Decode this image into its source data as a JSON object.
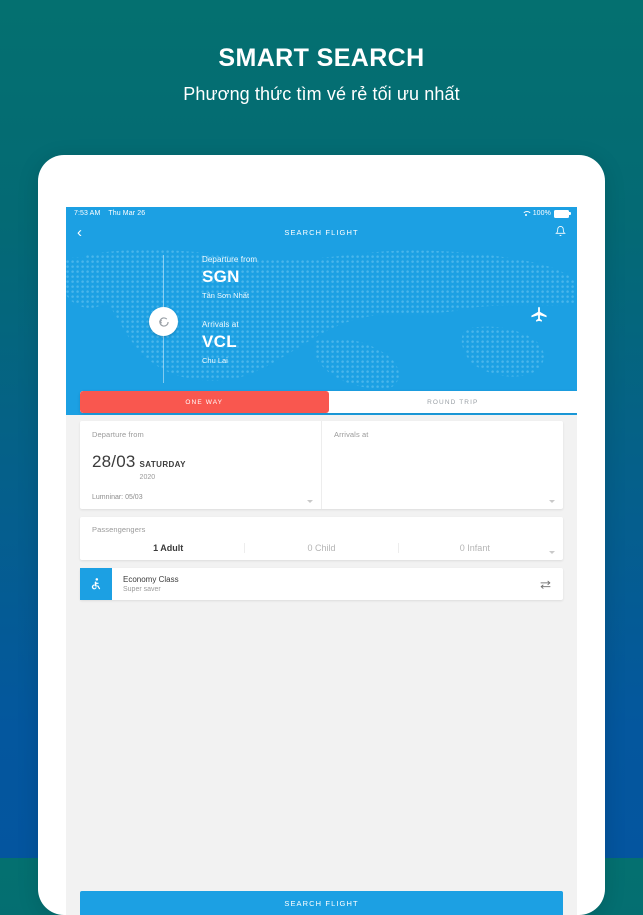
{
  "promo": {
    "title": "SMART SEARCH",
    "subtitle": "Phương thức tìm vé rẻ tối ưu nhất"
  },
  "statusbar": {
    "time": "7:53 AM",
    "date": "Thu Mar 26",
    "battery_pct": "100%",
    "wifi_icon": "wifi-icon",
    "battery_icon": "battery-icon"
  },
  "navbar": {
    "back_icon": "chevron-left-icon",
    "title": "SEARCH FLIGHT",
    "bell_icon": "bell-icon"
  },
  "hero": {
    "departure_label": "Departure from",
    "departure_code": "SGN",
    "departure_name": "Tân Sơn Nhất",
    "arrival_label": "Arrivals at",
    "arrival_code": "VCL",
    "arrival_name": "Chu Lai",
    "swap_icon": "swap-rotate-icon",
    "plane_icon": "airplane-icon"
  },
  "tabs": [
    {
      "label": "ONE WAY",
      "active": true
    },
    {
      "label": "ROUND TRIP",
      "active": false
    }
  ],
  "dates": {
    "depart": {
      "label": "Departure from",
      "day_month": "28/03",
      "weekday": "SATURDAY",
      "year": "2020",
      "lunar": "Lumninar:  05/03"
    },
    "arrive": {
      "label": "Arrivals at",
      "day_month": "",
      "weekday": "",
      "year": "",
      "lunar": ""
    }
  },
  "passengers": {
    "label": "Passengengers",
    "cells": [
      {
        "text": "1 Adult",
        "selected": true
      },
      {
        "text": "0 Child",
        "selected": false
      },
      {
        "text": "0 Infant",
        "selected": false
      }
    ]
  },
  "cabin": {
    "icon": "wheelchair-accessible-icon",
    "title": "Economy Class",
    "subtitle": "Super saver",
    "swap_icon": "swap-horizontal-icon"
  },
  "footer": {
    "search_label": "SEARCH FLIGHT"
  },
  "colors": {
    "bg_top": "#047070",
    "bg_bottom": "#04579E",
    "accent_blue": "#1CA0E3",
    "accent_red": "#F9574F",
    "screen_bg": "#F2F2F2"
  }
}
